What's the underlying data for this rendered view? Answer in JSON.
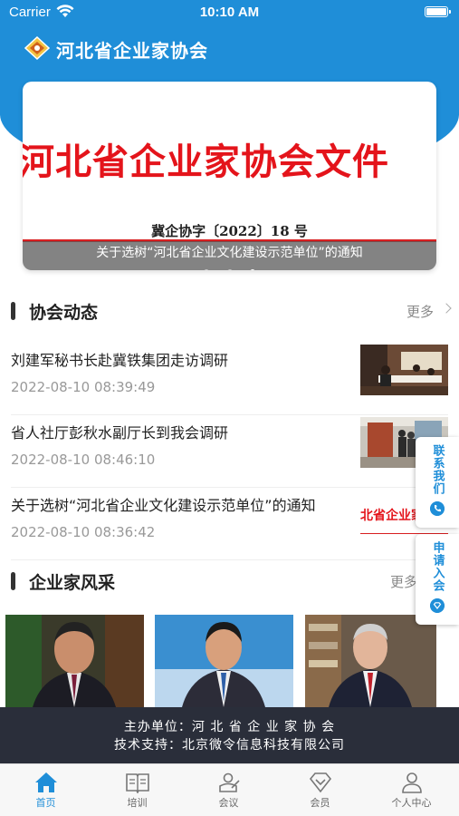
{
  "status_bar": {
    "carrier": "Carrier",
    "time": "10:10 AM"
  },
  "header": {
    "title": "河北省企业家协会"
  },
  "banner": {
    "doc_title": "河北省企业家协会文件",
    "doc_number": "冀企协字〔2022〕18 号",
    "caption": "关于选树“河北省企业文化建设示范单位”的通知",
    "slide_count": 3,
    "active_slide": 2
  },
  "news_section": {
    "title": "协会动态",
    "more": "更多",
    "items": [
      {
        "title": "刘建军秘书长赴冀铁集团走访调研",
        "date": "2022-08-10 08:39:49"
      },
      {
        "title": "省人社厅彭秋水副厅长到我会调研",
        "date": "2022-08-10 08:46:10"
      },
      {
        "title": "关于选树“河北省企业文化建设示范单位”的通知",
        "date": "2022-08-10 08:36:42",
        "thumb_text": "北省企业家"
      }
    ]
  },
  "people_section": {
    "title": "企业家风采",
    "more": "更多"
  },
  "float_buttons": {
    "contact": "联系我们",
    "apply": "申请入会"
  },
  "footer": {
    "line1": "主办单位：河 北 省 企 业 家 协 会",
    "line2": "技术支持：北京微令信息科技有限公司"
  },
  "tabs": [
    {
      "label": "首页",
      "icon": "home-icon",
      "active": true
    },
    {
      "label": "培训",
      "icon": "book-icon",
      "active": false
    },
    {
      "label": "会议",
      "icon": "meeting-icon",
      "active": false
    },
    {
      "label": "会员",
      "icon": "member-icon",
      "active": false
    },
    {
      "label": "个人中心",
      "icon": "user-icon",
      "active": false
    }
  ],
  "colors": {
    "brand": "#1f8ed8",
    "doc_red": "#e4141b",
    "footer_bg": "#2a2e3a"
  }
}
